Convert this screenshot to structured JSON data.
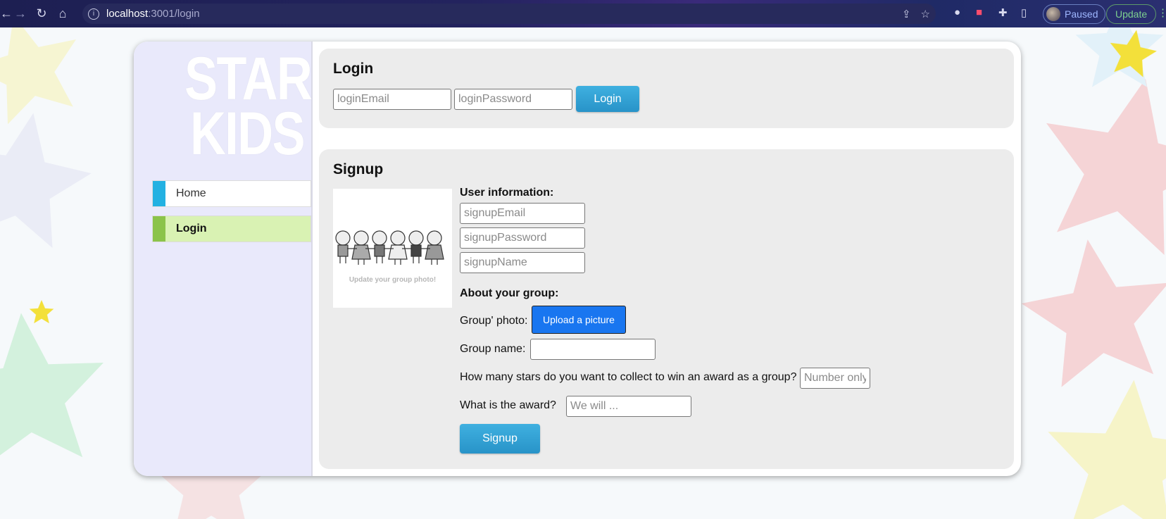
{
  "browser": {
    "url_host": "localhost",
    "url_path": ":3001/login",
    "profile_status": "Paused",
    "update_label": "Update"
  },
  "brand": {
    "logo_line1": "STAR",
    "logo_line2": "KIDS"
  },
  "sidebar": {
    "items": [
      {
        "label": "Home",
        "accent": "#23b1e2"
      },
      {
        "label": "Login",
        "accent": "#8bc34a",
        "active": true
      }
    ]
  },
  "login": {
    "title": "Login",
    "email_placeholder": "loginEmail",
    "password_placeholder": "loginPassword",
    "submit_label": "Login"
  },
  "signup": {
    "title": "Signup",
    "photo_caption": "Update your group photo!",
    "user_info_heading": "User information:",
    "email_placeholder": "signupEmail",
    "password_placeholder": "signupPassword",
    "name_placeholder": "signupName",
    "group_heading": "About your group:",
    "group_photo_label": "Group' photo:",
    "upload_label": "Upload a picture",
    "group_name_label": "Group name:",
    "stars_question": "How many stars do you want to collect to win an award as a group?",
    "stars_placeholder": "Number only",
    "award_question": "What is the award?",
    "award_placeholder": "We will ...",
    "submit_label": "Signup"
  },
  "colors": {
    "accent_blue": "#2893c8",
    "upload_blue": "#1976f0",
    "active_nav_bg": "#d9f2b3"
  }
}
